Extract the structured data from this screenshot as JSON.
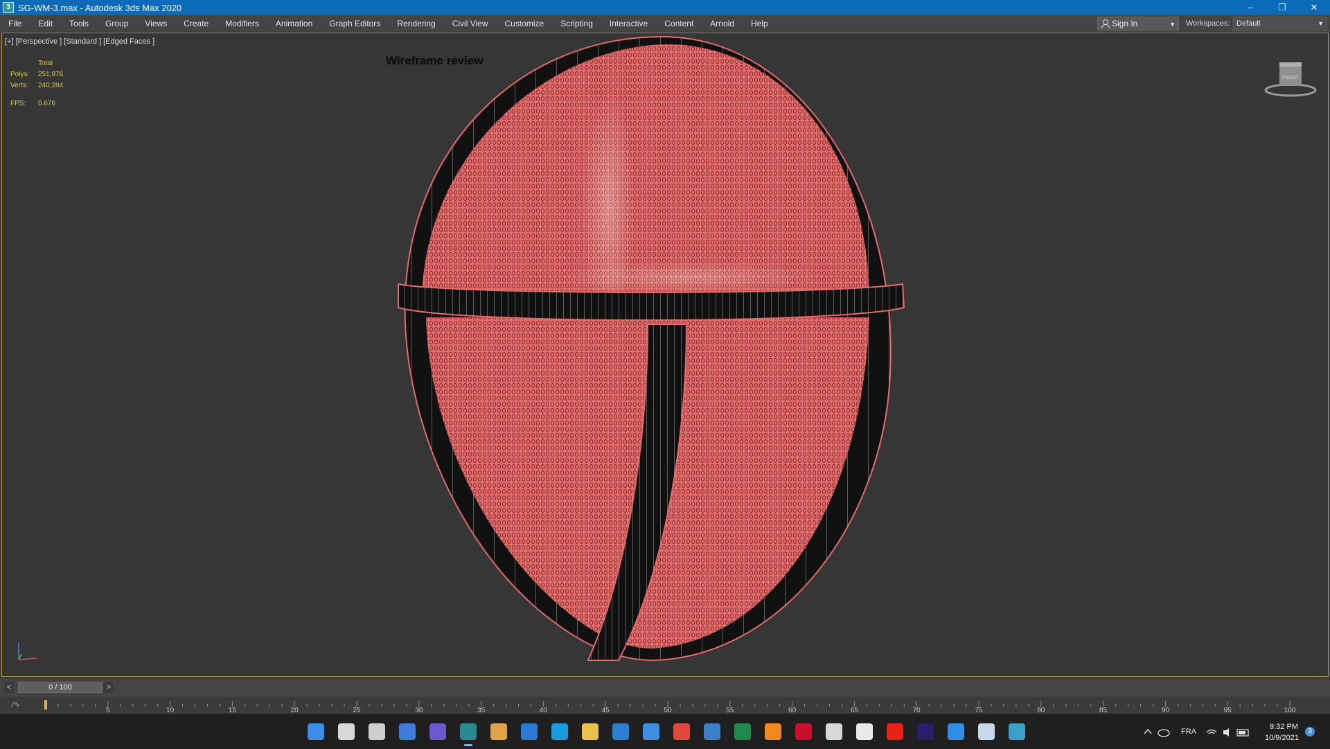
{
  "window": {
    "title": "SG-WM-3.max - Autodesk 3ds Max 2020",
    "app_icon_text": "3",
    "controls": [
      "–",
      "❐",
      "✕"
    ]
  },
  "menu": [
    "File",
    "Edit",
    "Tools",
    "Group",
    "Views",
    "Create",
    "Modifiers",
    "Animation",
    "Graph Editors",
    "Rendering",
    "Civil View",
    "Customize",
    "Scripting",
    "Interactive",
    "Content",
    "Arnold",
    "Help"
  ],
  "signin": {
    "label": "Sign In"
  },
  "workspaces": {
    "label": "Workspaces:",
    "value": "Default"
  },
  "viewport": {
    "label": "[+] [Perspective ] [Standard ] [Edged Faces ]",
    "overlay_title": "Wireframe review",
    "stats": {
      "header": "Total",
      "polys_label": "Polys:",
      "polys": "251,976",
      "verts_label": "Verts:",
      "verts": "240,284",
      "fps_label": "FPS:",
      "fps": "0.676"
    },
    "viewcube_label": "FRONT",
    "model_color": "#e36b6b",
    "border_color": "#b39a33"
  },
  "timeline": {
    "frame_display": "0 / 100",
    "prev": "<",
    "next": ">",
    "ticks": [
      "5",
      "10",
      "15",
      "20",
      "25",
      "30",
      "35",
      "40",
      "45",
      "50",
      "55",
      "60",
      "65",
      "70",
      "75",
      "80",
      "85",
      "90",
      "95",
      "100"
    ]
  },
  "taskbar": {
    "icons": [
      "windows-start-icon",
      "search-icon",
      "task-view-icon",
      "widgets-icon",
      "teams-chat-icon",
      "3dsmax-icon",
      "photos-icon",
      "edge-dev-icon",
      "edge-icon",
      "file-explorer-icon",
      "store-icon",
      "mail-icon",
      "git-icon",
      "network-app-icon",
      "excel-icon",
      "blender-icon",
      "netflix-icon",
      "autodesk-icon",
      "chrome-icon",
      "youtube-icon",
      "premiere-icon",
      "app-icon",
      "notepad-icon",
      "globe-icon"
    ],
    "language": "FRA",
    "time": "9:32 PM",
    "date": "10/9/2021",
    "notifications": "3"
  }
}
